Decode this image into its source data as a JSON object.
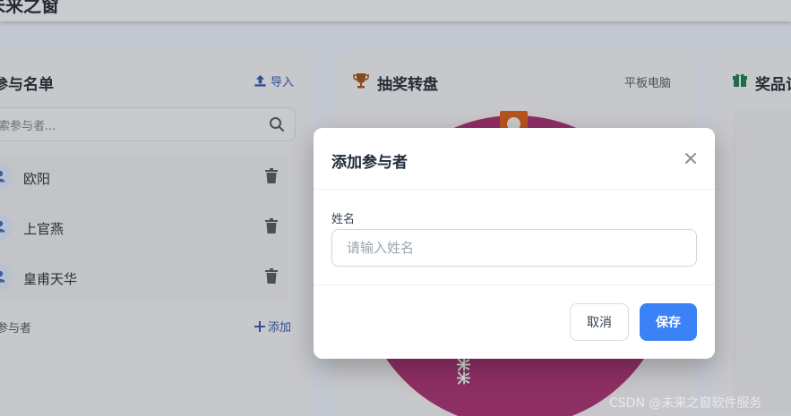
{
  "app": {
    "title": "未来之窗"
  },
  "participants_card": {
    "title": "参与名单",
    "import_label": "导入",
    "search_placeholder": "索参与者...",
    "items": [
      {
        "name": "欧阳"
      },
      {
        "name": "上官燕"
      },
      {
        "name": "皇甫天华"
      }
    ],
    "footer_label": "参与者",
    "add_label": "添加"
  },
  "wheel_card": {
    "title": "抽奖转盘",
    "subtitle": "平板电脑",
    "segment_label": "米米"
  },
  "prizes_card": {
    "title": "奖品记"
  },
  "modal": {
    "title": "添加参与者",
    "field_label": "姓名",
    "input_value": "",
    "input_placeholder": "请输入姓名",
    "cancel_label": "取消",
    "save_label": "保存"
  },
  "watermark": "CSDN @未来之窗软件服务",
  "colors": {
    "primary": "#3b82f6",
    "wheel": "#8e2f64",
    "pointer": "#b5541e",
    "overlay": "#c4c8d0"
  }
}
